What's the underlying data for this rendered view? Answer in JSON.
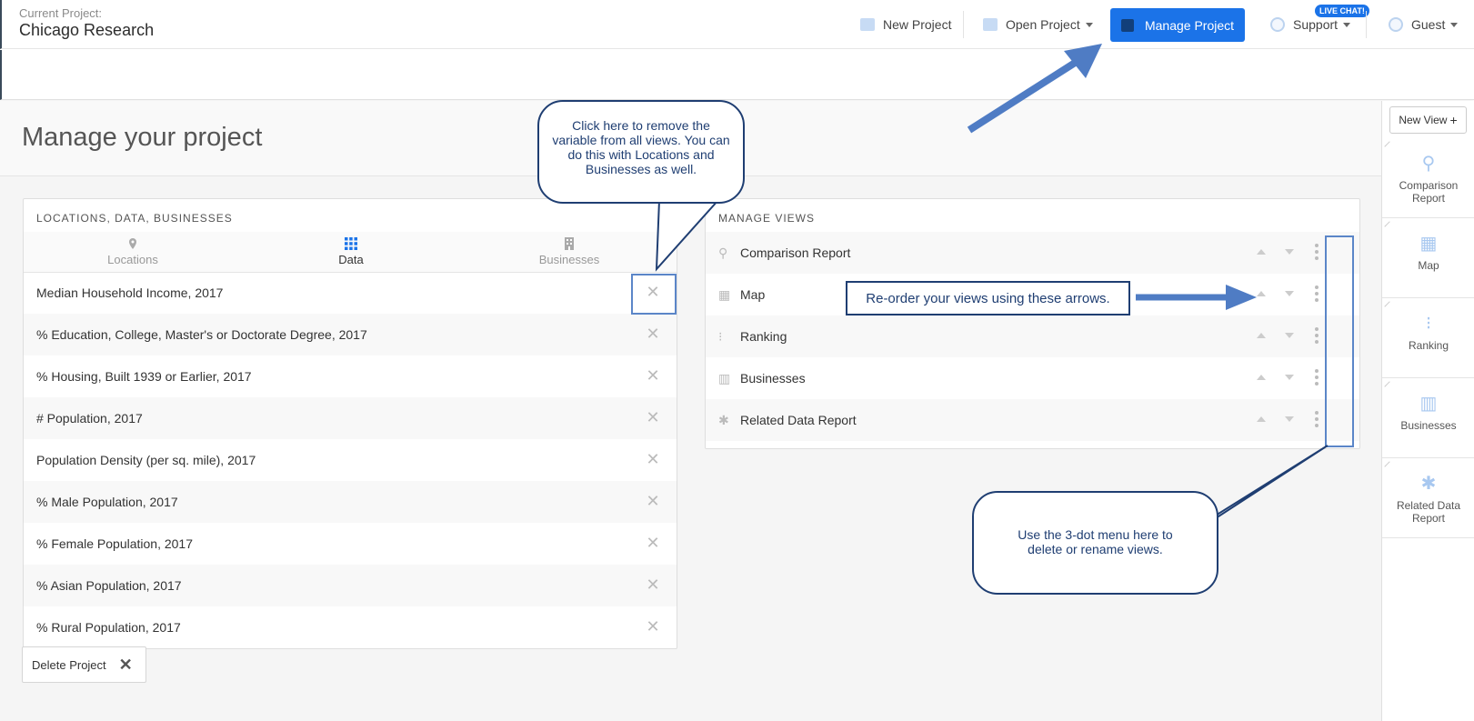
{
  "header": {
    "project_label": "Current Project:",
    "project_name": "Chicago Research",
    "new_project": "New Project",
    "open_project": "Open Project",
    "manage_project": "Manage Project",
    "support": "Support",
    "live_chat": "LIVE CHAT!",
    "guest": "Guest"
  },
  "page": {
    "title": "Manage your project"
  },
  "left_panel": {
    "heading": "LOCATIONS, DATA, BUSINESSES",
    "tabs": [
      {
        "label": "Locations",
        "icon": "map-pin-icon"
      },
      {
        "label": "Data",
        "icon": "grid-icon"
      },
      {
        "label": "Businesses",
        "icon": "building-icon"
      }
    ],
    "active_tab": "Data",
    "variables": [
      "Median Household Income, 2017",
      "% Education, College, Master's or Doctorate Degree, 2017",
      "% Housing, Built 1939 or Earlier, 2017",
      "# Population, 2017",
      "Population Density (per sq. mile), 2017",
      "% Male Population, 2017",
      "% Female Population, 2017",
      "% Asian Population, 2017",
      "% Rural Population, 2017"
    ]
  },
  "right_panel": {
    "heading": "MANAGE VIEWS",
    "views": [
      {
        "label": "Comparison Report",
        "icon": "comparison-icon"
      },
      {
        "label": "Map",
        "icon": "map-icon"
      },
      {
        "label": "Ranking",
        "icon": "ranking-icon"
      },
      {
        "label": "Businesses",
        "icon": "building-icon"
      },
      {
        "label": "Related Data Report",
        "icon": "snowflake-icon"
      }
    ]
  },
  "delete_project": "Delete Project",
  "sidebar": {
    "new_view": "New View",
    "items": [
      {
        "label": "Comparison Report"
      },
      {
        "label": "Map"
      },
      {
        "label": "Ranking"
      },
      {
        "label": "Businesses"
      },
      {
        "label": "Related Data Report"
      }
    ]
  },
  "callouts": {
    "remove": "Click here to remove the variable from all views. You can do this with Locations and Businesses as well.",
    "reorder": "Re-order your views using these arrows.",
    "menu": "Use the 3-dot menu here to delete or rename views."
  },
  "colors": {
    "accent": "#1b73e8",
    "callout_border": "#1f3e72",
    "highlight": "#5b86c8"
  }
}
